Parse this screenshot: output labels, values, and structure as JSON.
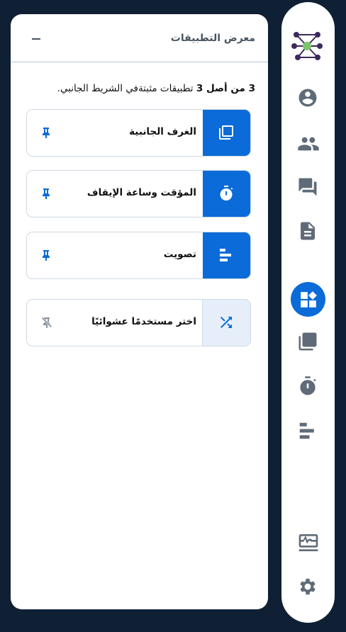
{
  "panel": {
    "title": "معرض التطبيقات",
    "minimize_label": "تصغير"
  },
  "info": {
    "count": "3",
    "middle": " من أصل ",
    "total": "3",
    "rest": " تطبيقات مثبتةفي الشريط الجانبي."
  },
  "apps": [
    {
      "label": "الغرف الجانبية",
      "icon": "breakout-rooms-icon",
      "pinned": true
    },
    {
      "label": "المؤقت وساعة الإيقاف",
      "icon": "timer-icon",
      "pinned": true
    },
    {
      "label": "تصويت",
      "icon": "poll-icon",
      "pinned": true
    },
    {
      "label": "اختر مستخدمًا عشوائيًا",
      "icon": "shuffle-icon",
      "pinned": false
    }
  ],
  "rail": {
    "items": [
      "profile-icon",
      "users-icon",
      "chat-icon",
      "notes-icon",
      "apps-icon",
      "breakout-rooms-icon",
      "timer-icon",
      "poll-icon",
      "connection-status-icon",
      "settings-icon"
    ],
    "active": "apps-icon"
  },
  "colors": {
    "background": "#0f2034",
    "accent": "#0b6bd8",
    "accent_light": "#e6eefa",
    "icon_gray": "#5f6b78"
  }
}
